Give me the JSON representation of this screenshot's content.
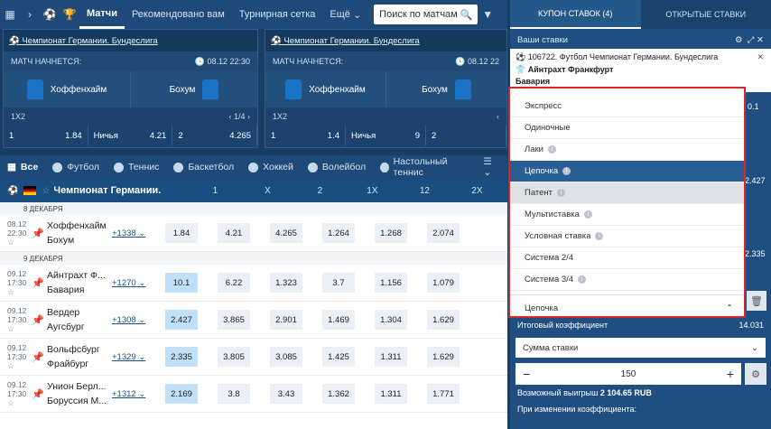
{
  "nav": {
    "tabs": [
      "Матчи",
      "Рекомендовано вам",
      "Турнирная сетка",
      "Ещё"
    ],
    "search_placeholder": "Поиск по матчам"
  },
  "cards": [
    {
      "league": "Чемпионат Германии. Бундеслига",
      "status": "МАТЧ НАЧНЕТСЯ:",
      "time": "08.12 22:30",
      "home": "Хоффенхайм",
      "away": "Бохум",
      "market": "1X2",
      "page": "1/4",
      "odds": [
        [
          "1",
          "1.84"
        ],
        [
          "Ничья",
          "4.21"
        ],
        [
          "2",
          "4.265"
        ]
      ]
    },
    {
      "league": "Чемпионат Германии. Бундеслига",
      "status": "МАТЧ НАЧНЕТСЯ:",
      "time": "08.12 22",
      "home": "Хоффенхайм",
      "away": "Бохум",
      "market": "1X2",
      "page": "",
      "odds": [
        [
          "1",
          "1.4"
        ],
        [
          "Ничья",
          "9"
        ],
        [
          "2",
          ""
        ]
      ]
    }
  ],
  "sports": [
    "Все",
    "Футбол",
    "Теннис",
    "Баскетбол",
    "Хоккей",
    "Волейбол",
    "Настольный теннис"
  ],
  "league": {
    "name": "Чемпионат Германии.",
    "cols": [
      "1",
      "X",
      "2",
      "1X",
      "12",
      "2X"
    ]
  },
  "dates": [
    "8 ДЕКАБРЯ",
    "9 ДЕКАБРЯ"
  ],
  "rows": [
    {
      "date": "08.12",
      "time": "22:30",
      "home": "Хоффенхайм",
      "away": "Бохум",
      "more": "+1338",
      "odds": [
        "1.84",
        "4.21",
        "4.265",
        "1.264",
        "1.268",
        "2.074"
      ],
      "sel": -1
    },
    {
      "date": "09.12",
      "time": "17:30",
      "home": "Айнтрахт Ф...",
      "away": "Бавария",
      "more": "+1270",
      "odds": [
        "10.1",
        "6.22",
        "1.323",
        "3.7",
        "1.156",
        "1.079"
      ],
      "sel": 0
    },
    {
      "date": "09.12",
      "time": "17:30",
      "home": "Вердер",
      "away": "Аугсбург",
      "more": "+1308",
      "odds": [
        "2.427",
        "3.865",
        "2.901",
        "1.469",
        "1.304",
        "1.629"
      ],
      "sel": 0
    },
    {
      "date": "09.12",
      "time": "17:30",
      "home": "Вольфсбург",
      "away": "Фрайбург",
      "more": "+1329",
      "odds": [
        "2.335",
        "3.805",
        "3.085",
        "1.425",
        "1.311",
        "1.629"
      ],
      "sel": 0
    },
    {
      "date": "09.12",
      "time": "17:30",
      "home": "Унион Берл...",
      "away": "Боруссия М...",
      "more": "+1312",
      "odds": [
        "2.169",
        "3.8",
        "3.43",
        "1.362",
        "1.311",
        "1.771"
      ],
      "sel": 0
    }
  ],
  "coupon": {
    "tab1": "КУПОН СТАВОК (4)",
    "tab2": "ОТКРЫТЫЕ СТАВКИ",
    "my_bets": "Ваши ставки",
    "bet_title": "106722. Футбол Чемпионат Германии. Бундеслига",
    "team1": "Айнтрахт Франкфурт",
    "team2": "Бавария",
    "right_vals": [
      "0.1",
      "2.427",
      "2.335"
    ],
    "total_label": "Итоговый коэффициент",
    "total": "14.031",
    "stake_label": "Сумма ставки",
    "stake": "150",
    "win_label": "Возможный выигрыш",
    "win": "2 104.65 RUB",
    "change_label": "При изменении коэффициента:"
  },
  "dropdown": {
    "items": [
      "Экспресс",
      "Одиночные",
      "Лаки",
      "Цепочка",
      "Патент",
      "Мультиставка",
      "Условная ставка",
      "Система 2/4",
      "Система 3/4"
    ],
    "info": [
      false,
      false,
      true,
      true,
      true,
      true,
      true,
      false,
      true
    ],
    "selected": "Цепочка"
  }
}
